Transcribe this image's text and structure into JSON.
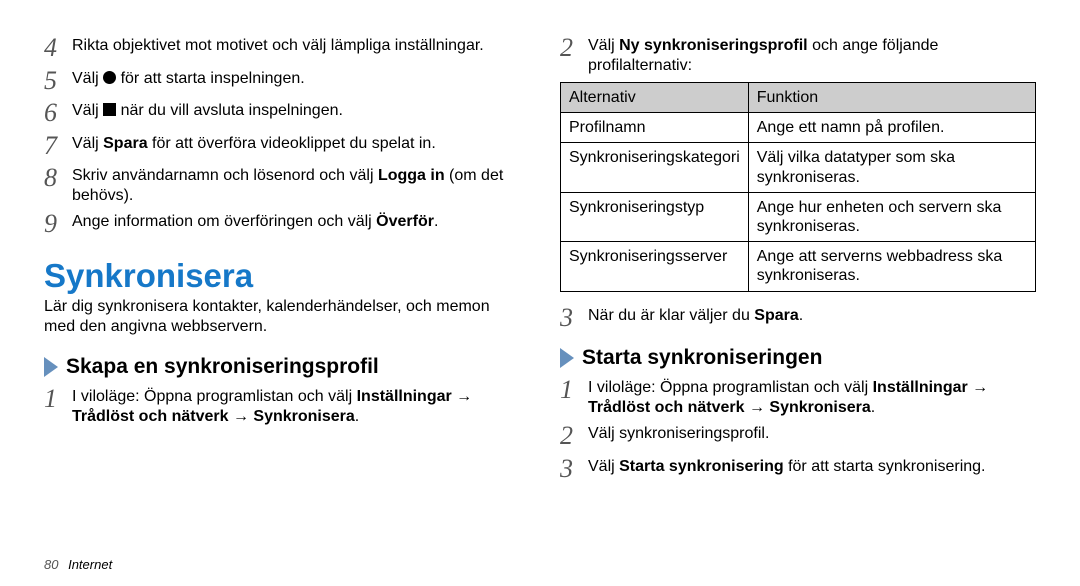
{
  "left": {
    "steps_top": [
      {
        "n": "4",
        "text": "Rikta objektivet mot motivet och välj lämpliga inställningar."
      },
      {
        "n": "5",
        "pre": "Välj ",
        "shape": "circle",
        "post": " för att starta inspelningen."
      },
      {
        "n": "6",
        "pre": "Välj ",
        "shape": "square",
        "post": " när du vill avsluta inspelningen."
      },
      {
        "n": "7",
        "pre": "Välj ",
        "b1": "Spara",
        "post": " för att överföra videoklippet du spelat in."
      },
      {
        "n": "8",
        "pre": "Skriv användarnamn och lösenord och välj ",
        "b1": "Logga in",
        "post": " (om det behövs)."
      },
      {
        "n": "9",
        "pre": "Ange information om överföringen och välj ",
        "b1": "Överför",
        "post": "."
      }
    ],
    "h1": "Synkronisera",
    "lead": "Lär dig synkronisera kontakter, kalenderhändelser, och memon med den angivna webbservern.",
    "sub1": "Skapa en synkroniseringsprofil",
    "step1": {
      "n": "1",
      "pre": "I viloläge: Öppna programlistan och välj ",
      "b1": "Inställningar",
      "arr1": " → ",
      "b2": "Trådlöst och nätverk",
      "arr2": " → ",
      "b3": "Synkronisera",
      "post": "."
    }
  },
  "right": {
    "step2": {
      "n": "2",
      "pre": "Välj ",
      "b1": "Ny synkroniseringsprofil",
      "post": " och ange följande profilalternativ:"
    },
    "table": {
      "h1": "Alternativ",
      "h2": "Funktion",
      "rows": [
        {
          "a": "Profilnamn",
          "b": "Ange ett namn på profilen."
        },
        {
          "a": "Synkroniseringskategori",
          "b": "Välj vilka datatyper som ska synkroniseras."
        },
        {
          "a": "Synkroniseringstyp",
          "b": "Ange hur enheten och servern ska synkroniseras."
        },
        {
          "a": "Synkroniseringsserver",
          "b": "Ange att serverns webbadress ska synkroniseras."
        }
      ]
    },
    "step3": {
      "n": "3",
      "pre": "När du är klar väljer du ",
      "b1": "Spara",
      "post": "."
    },
    "sub2": "Starta synkroniseringen",
    "s1": {
      "n": "1",
      "pre": "I viloläge: Öppna programlistan och välj ",
      "b1": "Inställningar",
      "arr1": " → ",
      "b2": "Trådlöst och nätverk",
      "arr2": " → ",
      "b3": "Synkronisera",
      "post": "."
    },
    "s2": {
      "n": "2",
      "text": "Välj synkroniseringsprofil."
    },
    "s3": {
      "n": "3",
      "pre": "Välj ",
      "b1": "Starta synkronisering",
      "post": " för att starta synkronisering."
    }
  },
  "footer": {
    "page": "80",
    "section": "Internet"
  }
}
